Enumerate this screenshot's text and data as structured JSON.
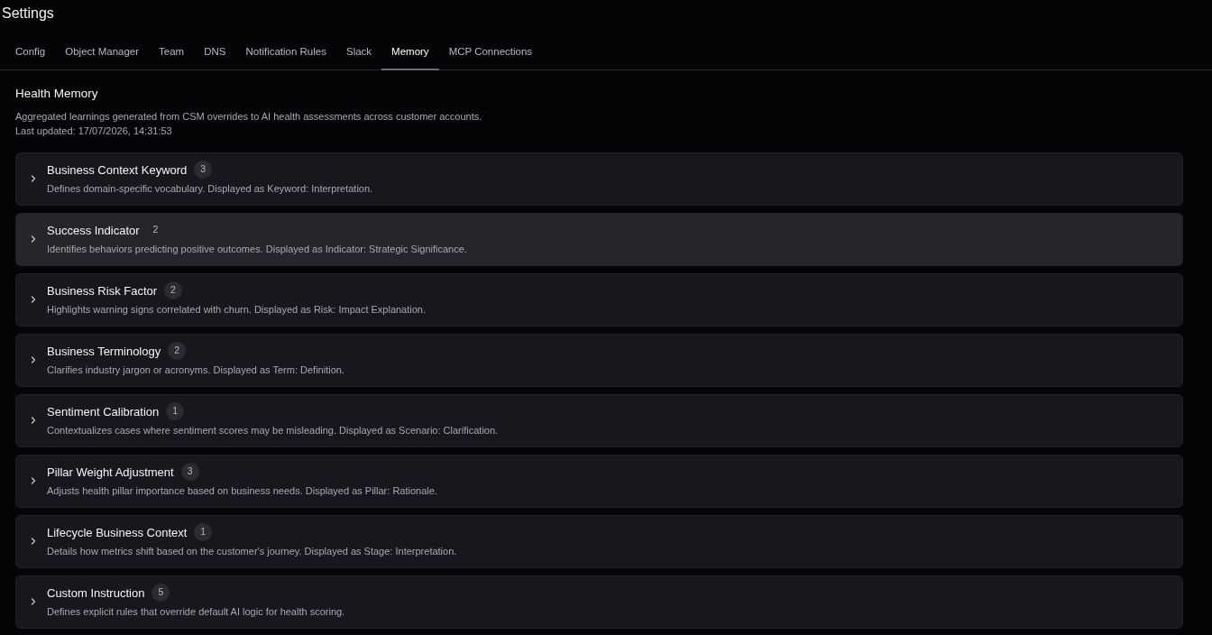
{
  "page_title": "Settings",
  "tabs": [
    {
      "label": "Config",
      "selected": false
    },
    {
      "label": "Object Manager",
      "selected": false
    },
    {
      "label": "Team",
      "selected": false
    },
    {
      "label": "DNS",
      "selected": false
    },
    {
      "label": "Notification Rules",
      "selected": false
    },
    {
      "label": "Slack",
      "selected": false
    },
    {
      "label": "Memory",
      "selected": true
    },
    {
      "label": "MCP Connections",
      "selected": false
    }
  ],
  "section": {
    "title": "Health Memory",
    "description": "Aggregated learnings generated from CSM overrides to AI health assessments across customer accounts.",
    "last_updated": "Last updated: 17/07/2026, 14:31:53"
  },
  "categories": [
    {
      "title": "Business Context Keyword",
      "count": "3",
      "description": "Defines domain-specific vocabulary. Displayed as Keyword: Interpretation.",
      "expanded": false,
      "highlighted": false
    },
    {
      "title": "Success Indicator",
      "count": "2",
      "description": "Identifies behaviors predicting positive outcomes. Displayed as Indicator: Strategic Significance.",
      "expanded": false,
      "highlighted": true
    },
    {
      "title": "Business Risk Factor",
      "count": "2",
      "description": "Highlights warning signs correlated with churn. Displayed as Risk: Impact Explanation.",
      "expanded": false,
      "highlighted": false
    },
    {
      "title": "Business Terminology",
      "count": "2",
      "description": "Clarifies industry jargon or acronyms. Displayed as Term: Definition.",
      "expanded": false,
      "highlighted": false
    },
    {
      "title": "Sentiment Calibration",
      "count": "1",
      "description": "Contextualizes cases where sentiment scores may be misleading. Displayed as Scenario: Clarification.",
      "expanded": false,
      "highlighted": false
    },
    {
      "title": "Pillar Weight Adjustment",
      "count": "3",
      "description": "Adjusts health pillar importance based on business needs. Displayed as Pillar: Rationale.",
      "expanded": false,
      "highlighted": false
    },
    {
      "title": "Lifecycle Business Context",
      "count": "1",
      "description": "Details how metrics shift based on the customer's journey. Displayed as Stage: Interpretation.",
      "expanded": false,
      "highlighted": false
    },
    {
      "title": "Custom Instruction",
      "count": "5",
      "description": "Defines explicit rules that override default AI logic for health scoring.",
      "expanded": false,
      "highlighted": false
    }
  ]
}
